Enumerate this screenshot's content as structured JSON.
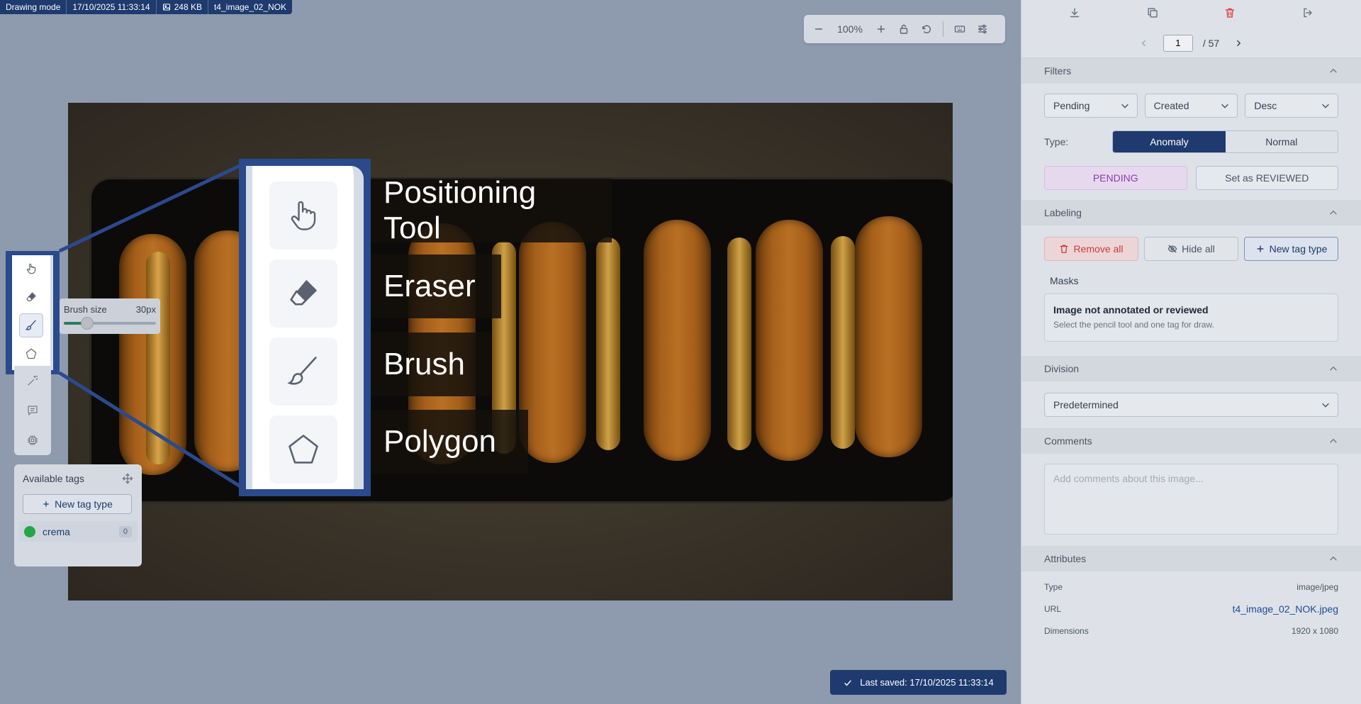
{
  "status_bar": {
    "mode": "Drawing mode",
    "timestamp": "17/10/2025 11:33:14",
    "size": "248 KB",
    "filename": "t4_image_02_NOK"
  },
  "zoom": {
    "value": "100%"
  },
  "callout": {
    "labels": [
      "Positioning Tool",
      "Eraser",
      "Brush",
      "Polygon"
    ]
  },
  "brush": {
    "label": "Brush size",
    "value": "30px",
    "level": 0.25
  },
  "tags_panel": {
    "title": "Available tags",
    "new_tag_label": "New tag type",
    "tags": [
      {
        "name": "crema",
        "count": "0",
        "color": "#23a64a"
      }
    ]
  },
  "toast": {
    "text": "Last saved: 17/10/2025 11:33:14"
  },
  "pager": {
    "current": "1",
    "total": "/ 57"
  },
  "filters": {
    "title": "Filters",
    "status": "Pending",
    "sort_by": "Created",
    "order": "Desc",
    "type_label": "Type:",
    "type_options": [
      "Anomaly",
      "Normal"
    ],
    "type_selected": "Anomaly",
    "pending_label": "PENDING",
    "review_label": "Set as REVIEWED"
  },
  "labeling": {
    "title": "Labeling",
    "remove_all": "Remove all",
    "hide_all": "Hide all",
    "new_tag": "New tag type",
    "masks_title": "Masks",
    "masks_empty_title": "Image not annotated or reviewed",
    "masks_empty_sub": "Select the pencil tool and one tag for draw."
  },
  "division": {
    "title": "Division",
    "value": "Predetermined"
  },
  "comments": {
    "title": "Comments",
    "placeholder": "Add comments about this image..."
  },
  "attributes": {
    "title": "Attributes",
    "rows": [
      {
        "key": "Type",
        "value": "image/jpeg"
      },
      {
        "key": "URL",
        "value": "t4_image_02_NOK.jpeg"
      },
      {
        "key": "Dimensions",
        "value": "1920 x 1080"
      }
    ]
  },
  "colors": {
    "brand": "#1e3a6e",
    "accent_green": "#23a64a",
    "danger": "#d03a3a",
    "pending": "#8a3bb4"
  }
}
